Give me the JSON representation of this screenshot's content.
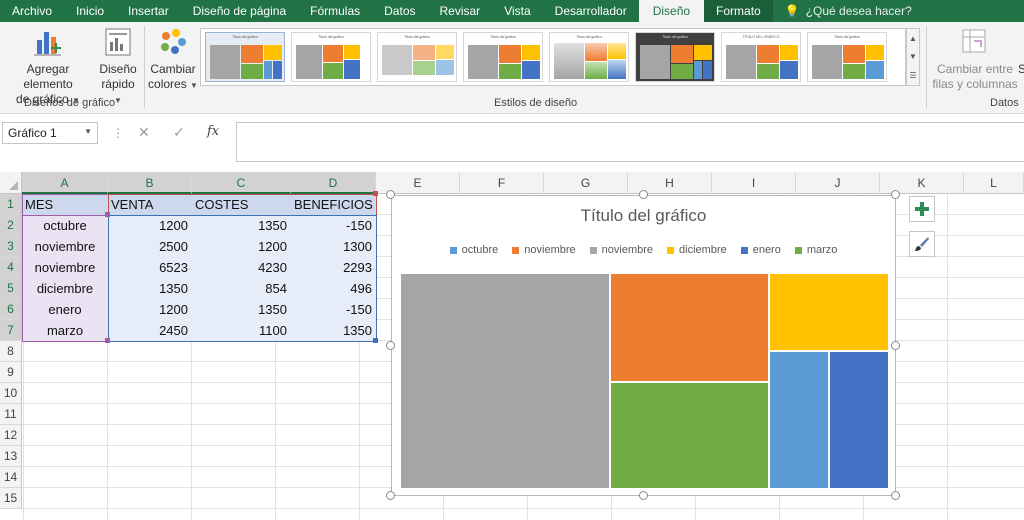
{
  "ribbon_tabs": {
    "archivo": "Archivo",
    "inicio": "Inicio",
    "insertar": "Insertar",
    "diseno_pagina": "Diseño de página",
    "formulas": "Fórmulas",
    "datos": "Datos",
    "revisar": "Revisar",
    "vista": "Vista",
    "desarrollador": "Desarrollador",
    "diseno": "Diseño",
    "formato": "Formato",
    "search": "¿Qué desea hacer?"
  },
  "ribbon": {
    "add_element_line1": "Agregar elemento",
    "add_element_line2": "de gráfico",
    "quick_layout_line1": "Diseño",
    "quick_layout_line2": "rápido",
    "change_colors_line1": "Cambiar",
    "change_colors_line2": "colores",
    "group_layouts": "Diseños de gráfico",
    "group_styles": "Estilos de diseño",
    "switch_line1": "Cambiar entre",
    "switch_line2": "filas y columnas",
    "switch_cut": "S",
    "group_data": "Datos",
    "style_thumb_titles": [
      "Título del gráfico",
      "Título del gráfico",
      "Título del gráfico",
      "Título del gráfico",
      "Título del gráfico",
      "Título del gráfico",
      "TÍTULO DEL GRÁFICO",
      "Título del gráfico"
    ]
  },
  "formula_bar": {
    "name_box": "Gráfico 1",
    "fx": "fx",
    "cancel": "✕",
    "enter": "✓"
  },
  "columns": [
    "A",
    "B",
    "C",
    "D",
    "E",
    "F",
    "G",
    "H",
    "I",
    "J",
    "K",
    "L"
  ],
  "rows": [
    "1",
    "2",
    "3",
    "4",
    "5",
    "6",
    "7",
    "8",
    "9",
    "10",
    "11",
    "12",
    "13",
    "14",
    "15"
  ],
  "table": {
    "headers": [
      "MES",
      "VENTA",
      "COSTES",
      "BENEFICIOS"
    ],
    "rows": [
      [
        "octubre",
        "1200",
        "1350",
        "-150"
      ],
      [
        "noviembre",
        "2500",
        "1200",
        "1300"
      ],
      [
        "noviembre",
        "6523",
        "4230",
        "2293"
      ],
      [
        "diciembre",
        "1350",
        "854",
        "496"
      ],
      [
        "enero",
        "1200",
        "1350",
        "-150"
      ],
      [
        "marzo",
        "2450",
        "1100",
        "1350"
      ]
    ]
  },
  "colors": {
    "excel_green": "#217346",
    "octubre": "#5B9BD5",
    "noviembre_1": "#ED7D31",
    "noviembre_2": "#A5A5A5",
    "diciembre": "#FFC000",
    "enero": "#4472C4",
    "marzo": "#70AD47"
  },
  "chart_data": {
    "type": "treemap",
    "title": "Título del gráfico",
    "legend_position": "top",
    "categories": [
      "octubre",
      "noviembre",
      "noviembre",
      "diciembre",
      "enero",
      "marzo"
    ],
    "values": [
      1200,
      2500,
      6523,
      1350,
      1200,
      2450
    ],
    "series_colors": [
      "#5B9BD5",
      "#ED7D31",
      "#A5A5A5",
      "#FFC000",
      "#4472C4",
      "#70AD47"
    ]
  }
}
